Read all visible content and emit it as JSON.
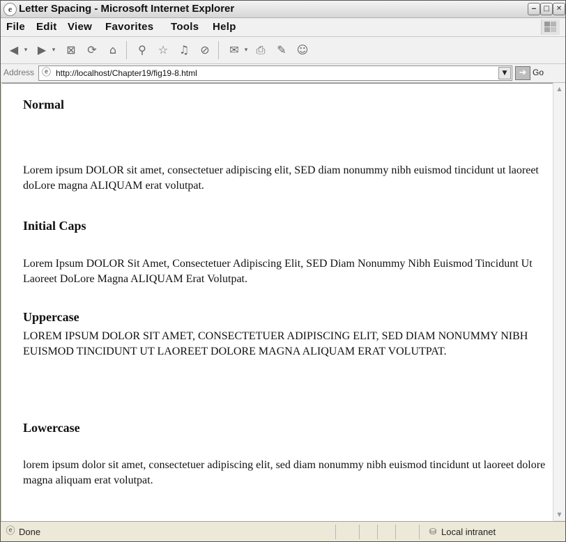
{
  "window": {
    "title": "Letter Spacing - Microsoft Internet Explorer",
    "controls": [
      "minimize",
      "maximize",
      "close"
    ]
  },
  "menubar": {
    "items": [
      "File",
      "Edit",
      "View",
      "Favorites",
      "Tools",
      "Help"
    ]
  },
  "toolbar": {
    "icons": [
      "back-icon",
      "forward-icon",
      "stop-icon",
      "refresh-icon",
      "home-icon",
      "search-icon",
      "favorites-icon",
      "media-icon",
      "history-icon",
      "mail-icon",
      "print-icon",
      "edit-icon",
      "messenger-icon"
    ]
  },
  "address": {
    "label": "Address",
    "url": "http://localhost/Chapter19/fig19-8.html",
    "go": "Go"
  },
  "document": {
    "sections": [
      {
        "heading": "Normal",
        "text": "Lorem ipsum DOLOR sit amet, consectetuer adipiscing elit, SED diam nonummy nibh euismod tincidunt ut laoreet doLore magna ALIQUAM erat volutpat."
      },
      {
        "heading": "Initial Caps",
        "text": "Lorem Ipsum DOLOR Sit Amet, Consectetuer Adipiscing Elit, SED Diam Nonummy Nibh Euismod Tincidunt Ut Laoreet DoLore Magna ALIQUAM Erat Volutpat."
      },
      {
        "heading": "Uppercase",
        "text": "LOREM IPSUM DOLOR SIT AMET, CONSECTETUER ADIPISCING ELIT, SED DIAM NONUMMY NIBH EUISMOD TINCIDUNT UT LAOREET DOLORE MAGNA ALIQUAM ERAT VOLUTPAT."
      },
      {
        "heading": "Lowercase",
        "text": "lorem ipsum dolor sit amet, consectetuer adipiscing elit, sed diam nonummy nibh euismod tincidunt ut laoreet dolore magna aliquam erat volutpat."
      }
    ]
  },
  "statusbar": {
    "status": "Done",
    "zone": "Local intranet"
  }
}
